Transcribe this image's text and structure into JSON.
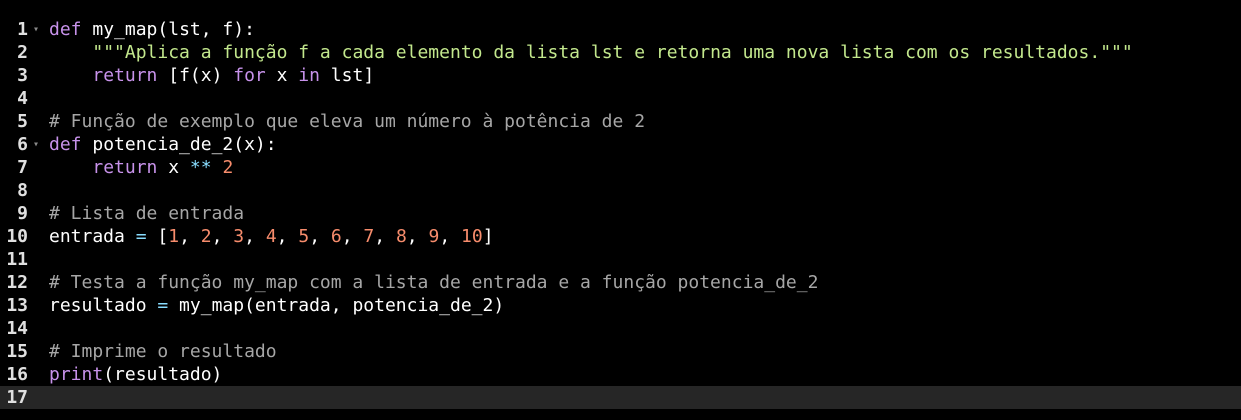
{
  "editor": {
    "fold_marker": "▾",
    "lines": [
      {
        "num": "1",
        "foldable": true,
        "tokens": [
          {
            "t": "kw",
            "v": "def"
          },
          {
            "t": "pl",
            "v": " "
          },
          {
            "t": "fn",
            "v": "my_map"
          },
          {
            "t": "pl",
            "v": "(lst, f):"
          }
        ]
      },
      {
        "num": "2",
        "tokens": [
          {
            "t": "pl",
            "v": "    "
          },
          {
            "t": "str",
            "v": "\"\"\"Aplica a função f a cada elemento da lista lst e retorna uma nova lista com os resultados.\"\"\""
          }
        ]
      },
      {
        "num": "3",
        "tokens": [
          {
            "t": "pl",
            "v": "    "
          },
          {
            "t": "kw",
            "v": "return"
          },
          {
            "t": "pl",
            "v": " [f(x) "
          },
          {
            "t": "kw",
            "v": "for"
          },
          {
            "t": "pl",
            "v": " x "
          },
          {
            "t": "kw",
            "v": "in"
          },
          {
            "t": "pl",
            "v": " lst]"
          }
        ]
      },
      {
        "num": "4",
        "tokens": []
      },
      {
        "num": "5",
        "tokens": [
          {
            "t": "cm",
            "v": "# Função de exemplo que eleva um número à potência de 2"
          }
        ]
      },
      {
        "num": "6",
        "foldable": true,
        "tokens": [
          {
            "t": "kw",
            "v": "def"
          },
          {
            "t": "pl",
            "v": " "
          },
          {
            "t": "fn",
            "v": "potencia_de_2"
          },
          {
            "t": "pl",
            "v": "(x):"
          }
        ]
      },
      {
        "num": "7",
        "tokens": [
          {
            "t": "pl",
            "v": "    "
          },
          {
            "t": "kw",
            "v": "return"
          },
          {
            "t": "pl",
            "v": " x "
          },
          {
            "t": "op",
            "v": "**"
          },
          {
            "t": "pl",
            "v": " "
          },
          {
            "t": "num",
            "v": "2"
          }
        ]
      },
      {
        "num": "8",
        "tokens": []
      },
      {
        "num": "9",
        "tokens": [
          {
            "t": "cm",
            "v": "# Lista de entrada"
          }
        ]
      },
      {
        "num": "10",
        "tokens": [
          {
            "t": "pl",
            "v": "entrada "
          },
          {
            "t": "op",
            "v": "="
          },
          {
            "t": "pl",
            "v": " ["
          },
          {
            "t": "num",
            "v": "1"
          },
          {
            "t": "pl",
            "v": ", "
          },
          {
            "t": "num",
            "v": "2"
          },
          {
            "t": "pl",
            "v": ", "
          },
          {
            "t": "num",
            "v": "3"
          },
          {
            "t": "pl",
            "v": ", "
          },
          {
            "t": "num",
            "v": "4"
          },
          {
            "t": "pl",
            "v": ", "
          },
          {
            "t": "num",
            "v": "5"
          },
          {
            "t": "pl",
            "v": ", "
          },
          {
            "t": "num",
            "v": "6"
          },
          {
            "t": "pl",
            "v": ", "
          },
          {
            "t": "num",
            "v": "7"
          },
          {
            "t": "pl",
            "v": ", "
          },
          {
            "t": "num",
            "v": "8"
          },
          {
            "t": "pl",
            "v": ", "
          },
          {
            "t": "num",
            "v": "9"
          },
          {
            "t": "pl",
            "v": ", "
          },
          {
            "t": "num",
            "v": "10"
          },
          {
            "t": "pl",
            "v": "]"
          }
        ]
      },
      {
        "num": "11",
        "tokens": []
      },
      {
        "num": "12",
        "tokens": [
          {
            "t": "cm",
            "v": "# Testa a função my_map com a lista de entrada e a função potencia_de_2"
          }
        ]
      },
      {
        "num": "13",
        "tokens": [
          {
            "t": "pl",
            "v": "resultado "
          },
          {
            "t": "op",
            "v": "="
          },
          {
            "t": "pl",
            "v": " my_map(entrada, potencia_de_2)"
          }
        ]
      },
      {
        "num": "14",
        "tokens": []
      },
      {
        "num": "15",
        "tokens": [
          {
            "t": "cm",
            "v": "# Imprime o resultado"
          }
        ]
      },
      {
        "num": "16",
        "tokens": [
          {
            "t": "kw",
            "v": "print"
          },
          {
            "t": "pl",
            "v": "(resultado)"
          }
        ]
      },
      {
        "num": "17",
        "current": true,
        "tokens": []
      }
    ]
  }
}
